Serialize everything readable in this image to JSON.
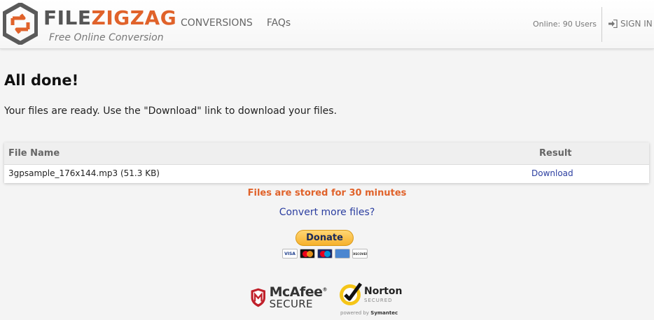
{
  "header": {
    "logo_part1": "FILE",
    "logo_part2": "ZIGZAG",
    "tagline": "Free Online Conversion",
    "nav": [
      {
        "label": "CONVERSIONS"
      },
      {
        "label": "FAQs"
      }
    ],
    "online_text": "Online: 90 Users",
    "signin_label": "SIGN IN",
    "signin_icon": "sign-in-icon"
  },
  "main": {
    "title": "All done!",
    "subtitle": "Your files are ready. Use the \"Download\" link to download your files.",
    "table": {
      "col_name": "File Name",
      "col_result": "Result",
      "rows": [
        {
          "name": "3gpsample_176x144.mp3 (51.3 KB)",
          "result": "Download"
        }
      ]
    },
    "stored_text": "Files are stored for 30 minutes",
    "convert_more": "Convert more files?"
  },
  "donate": {
    "label": "Donate",
    "cards": [
      "VISA",
      "mastercard",
      "maestro",
      "AMEX",
      "DISCOVER"
    ]
  },
  "badges": {
    "mcafee_name": "McAfee",
    "mcafee_reg": "®",
    "mcafee_sub": "SECURE",
    "norton_name": "Norton",
    "norton_secured": "SECURED",
    "norton_powered": "powered by",
    "norton_symantec": "Symantec"
  },
  "colors": {
    "accent": "#e0622a",
    "link": "#2b3ea0",
    "logo_gray": "#555555",
    "donate_gold": "#f7b12b",
    "norton_yellow": "#f5c518",
    "mcafee_red": "#c0202a"
  }
}
